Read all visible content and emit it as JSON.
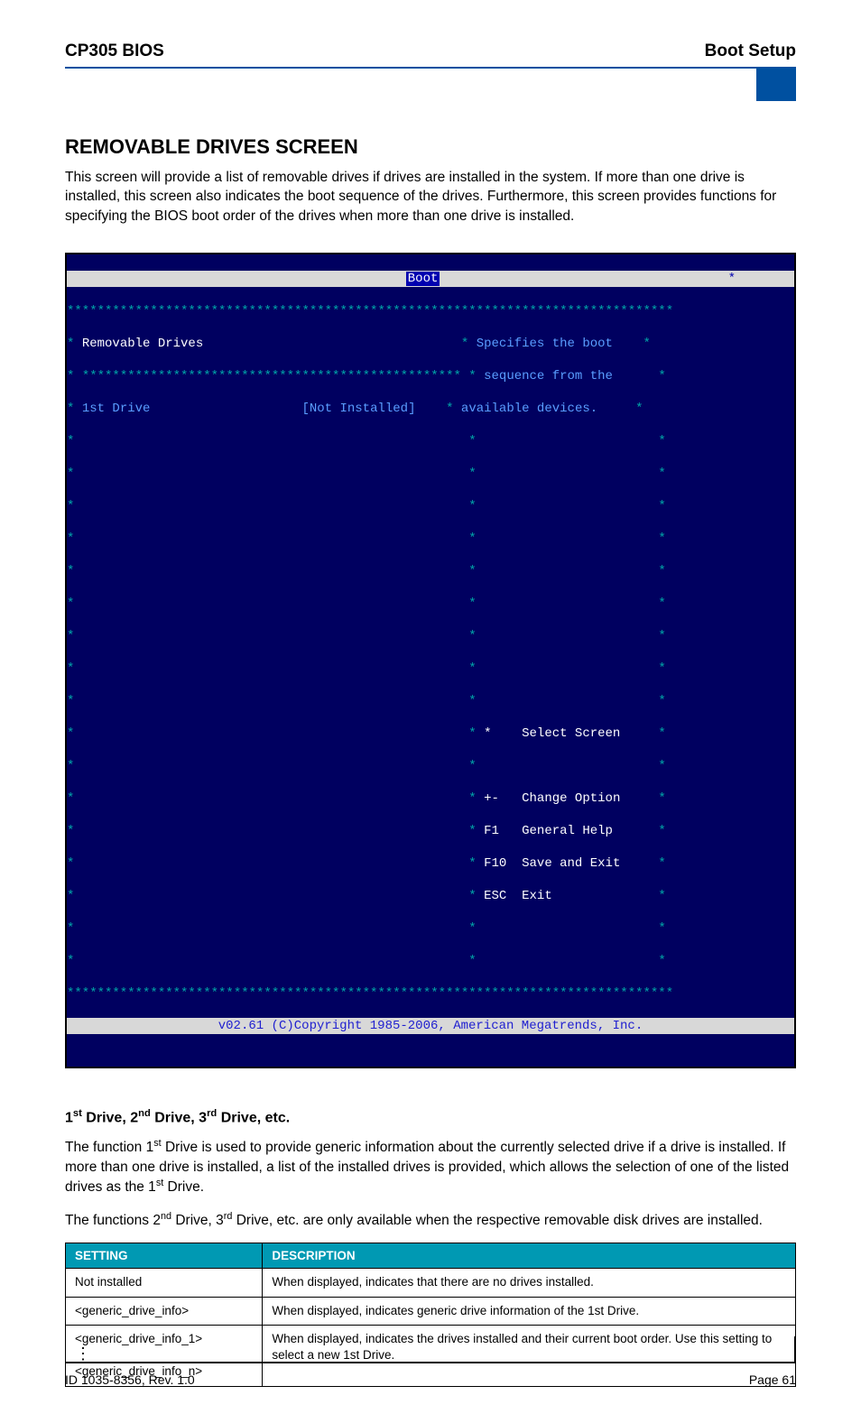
{
  "header": {
    "left": "CP305 BIOS",
    "right": "Boot Setup"
  },
  "section_title": "REMOVABLE DRIVES SCREEN",
  "section_body": "This screen will provide a list of removable drives if drives are installed in the system. If more than one drive is installed, this screen also indicates the boot sequence of the drives. Furthermore, this screen provides functions for specifying the BIOS boot order of the drives when more than one drive is installed.",
  "bios": {
    "title_label": "Boot",
    "group_label": "Removable Drives",
    "item_label": "1st Drive",
    "item_value": "[Not Installed]",
    "help1": "Specifies the boot",
    "help2": "sequence from the",
    "help3": "available devices.",
    "k_select": "Select Screen",
    "k_change": "Change Option",
    "k_help": "General Help",
    "k_save": "Save and Exit",
    "k_exit": "Exit",
    "key_select": "*",
    "key_updown": "+-",
    "key_f1": "F1",
    "key_f10": "F10",
    "key_esc": "ESC",
    "copyright": "v02.61 (C)Copyright 1985-2006, American Megatrends, Inc."
  },
  "sub_heading": "1st Drive, 2nd Drive, 3rd Drive, etc.",
  "para1_a": "The function 1",
  "para1_b": " Drive is used to provide generic information about the currently selected drive if a drive is installed. If more than one drive is installed, a list of the installed drives is provided, which allows the selection of one of the listed drives as the 1",
  "para1_c": " Drive.",
  "para2_a": "The functions 2",
  "para2_b": " Drive, 3",
  "para2_c": " Drive, etc. are only available when the respective removable disk drives are installed.",
  "table": {
    "h1": "SETTING",
    "h2": "DESCRIPTION",
    "r1c1": "Not installed",
    "r1c2": "When displayed, indicates that there are no drives installed.",
    "r2c1": "<generic_drive_info>",
    "r2c2": "When displayed, indicates generic drive information of the 1st Drive.",
    "r3c1a": "<generic_drive_info_1>",
    "r3c1b": "<generic_drive_info_n>",
    "r3c2": "When displayed, indicates the drives installed and their current boot order. Use this setting to select a new 1st Drive."
  },
  "footer": {
    "left": "ID 1035-8356, Rev. 1.0",
    "right": "Page 61"
  }
}
